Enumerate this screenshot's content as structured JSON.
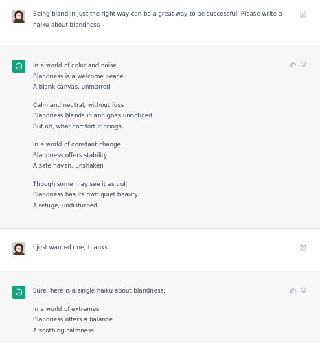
{
  "conversation": [
    {
      "role": "user",
      "avatar_icon": "user-photo-avatar",
      "text": "Being bland in just the right way can be a great way to be successful.  Please write a haiku about blandness"
    },
    {
      "role": "assistant",
      "avatar_icon": "openai-logo-icon",
      "stanzas": [
        [
          "In a world of color and noise",
          "Blandness is a welcome peace",
          "A blank canvas, unmarred"
        ],
        [
          "Calm and neutral, without fuss",
          "Blandness blends in and goes unnoticed",
          "But oh, what comfort it brings"
        ],
        [
          "In a world of constant change",
          "Blandness offers stability",
          "A safe haven, unshaken"
        ],
        [
          "Though some may see it as dull",
          "Blandness has its own quiet beauty",
          "A refuge, undisturbed"
        ]
      ]
    },
    {
      "role": "user",
      "avatar_icon": "user-photo-avatar",
      "text": "I just wanted one, thanks"
    },
    {
      "role": "assistant",
      "avatar_icon": "openai-logo-icon",
      "intro": "Sure, here is a single haiku about blandness:",
      "stanzas": [
        [
          "In a world of extremes",
          "Blandness offers a balance",
          "A soothing calmness"
        ]
      ]
    }
  ],
  "colors": {
    "assistant_bg": "#f7f7f8",
    "user_bg": "#ffffff",
    "openai_green": "#10a37f",
    "text": "#374151",
    "icon_gray": "#acacbe"
  }
}
